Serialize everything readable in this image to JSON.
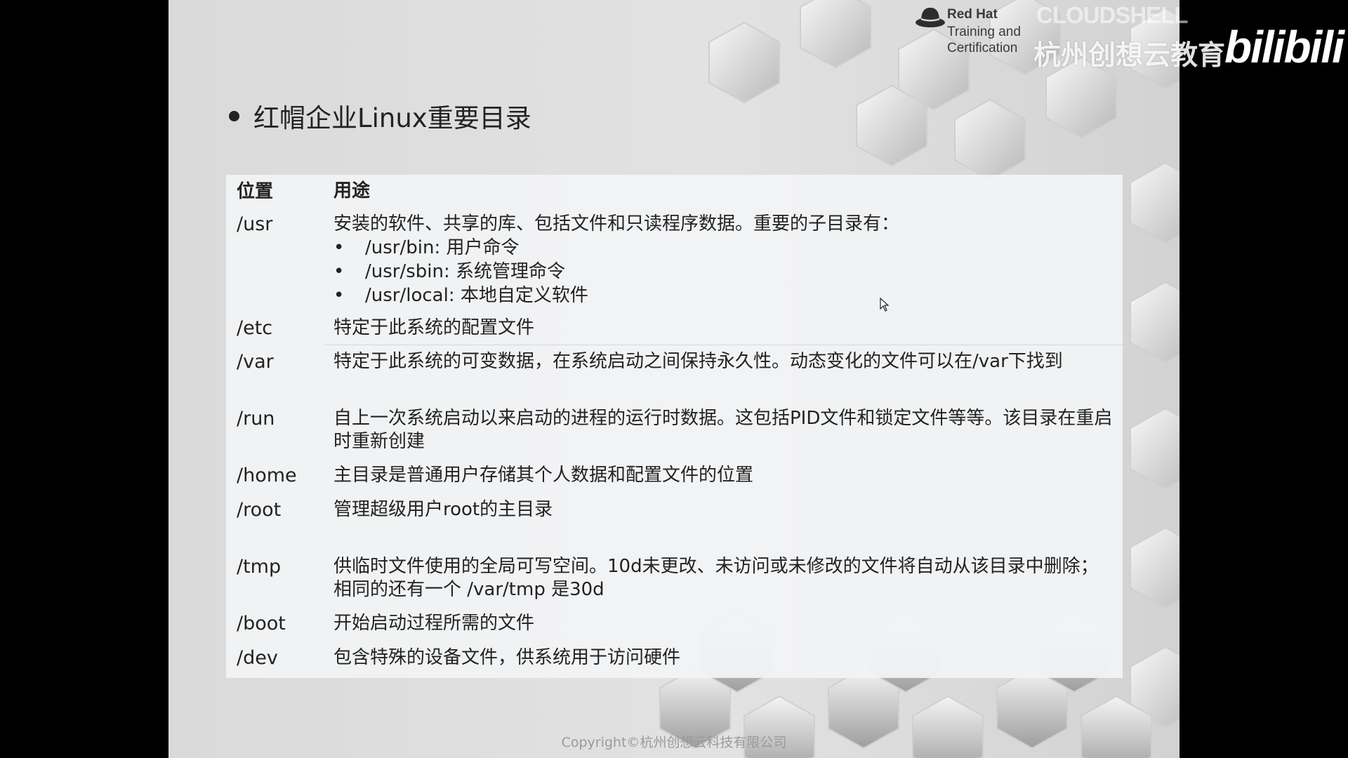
{
  "slide": {
    "logo": {
      "name": "Red Hat",
      "subtitle": "Training and Certification"
    },
    "title": "红帽企业Linux重要目录",
    "table": {
      "headers": {
        "path": "位置",
        "desc": "用途"
      },
      "rows": [
        {
          "path": "/usr",
          "desc": "安装的软件、共享的库、包括文件和只读程序数据。重要的子目录有：",
          "bullets": [
            "/usr/bin: 用户命令",
            "/usr/sbin: 系统管理命令",
            "/usr/local: 本地自定义软件"
          ]
        },
        {
          "path": "/etc",
          "desc": "特定于此系统的配置文件"
        },
        {
          "path": "/var",
          "desc": "特定于此系统的可变数据，在系统启动之间保持永久性。动态变化的文件可以在/var下找到"
        },
        {
          "path": "/run",
          "desc": "自上一次系统启动以来启动的进程的运行时数据。这包括PID文件和锁定文件等等。该目录在重启时重新创建"
        },
        {
          "path": "/home",
          "desc": "主目录是普通用户存储其个人数据和配置文件的位置"
        },
        {
          "path": "/root",
          "desc": "管理超级用户root的主目录"
        },
        {
          "path": "/tmp",
          "desc": "供临时文件使用的全局可写空间。10d未更改、未访问或未修改的文件将自动从该目录中删除；相同的还有一个 /var/tmp 是30d"
        },
        {
          "path": "/boot",
          "desc": "开始启动过程所需的文件"
        },
        {
          "path": "/dev",
          "desc": "包含特殊的设备文件，供系统用于访问硬件"
        }
      ]
    },
    "copyright": "Copyright©杭州创想云科技有限公司"
  },
  "watermarks": {
    "cloudshell": "CLOUDSHELL",
    "edu": "杭州创想云教育",
    "bilibili": "bilibili"
  },
  "colors": {
    "text": "#222222",
    "table_bg": "#f2f3f4",
    "copyright": "#9a9a9a"
  }
}
